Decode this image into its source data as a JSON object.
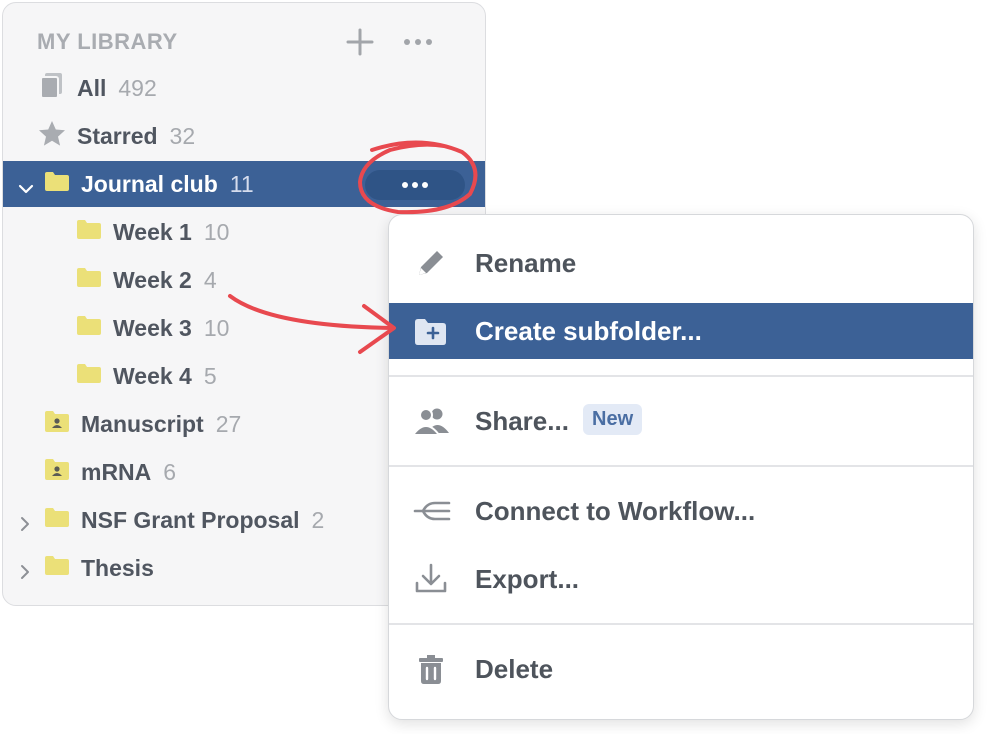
{
  "library": {
    "header": "MY LIBRARY",
    "add_icon": "plus-icon",
    "more_icon": "more-horizontal-icon",
    "items": [
      {
        "label": "All",
        "count": "492",
        "icon": "documents-icon"
      },
      {
        "label": "Starred",
        "count": "32",
        "icon": "star-icon"
      },
      {
        "label": "Journal club",
        "count": "11",
        "icon": "folder-icon",
        "expanded": true,
        "selected": true
      },
      {
        "label": "Week 1",
        "count": "10",
        "icon": "folder-icon"
      },
      {
        "label": "Week 2",
        "count": "4",
        "icon": "folder-icon"
      },
      {
        "label": "Week 3",
        "count": "10",
        "icon": "folder-icon"
      },
      {
        "label": "Week 4",
        "count": "5",
        "icon": "folder-icon"
      },
      {
        "label": "Manuscript",
        "count": "27",
        "icon": "shared-folder-icon"
      },
      {
        "label": "mRNA",
        "count": "6",
        "icon": "shared-folder-icon"
      },
      {
        "label": "NSF Grant Proposal",
        "count": "2",
        "icon": "folder-icon",
        "collapsed": true
      },
      {
        "label": "Thesis",
        "count": "",
        "icon": "folder-icon",
        "collapsed": true
      }
    ]
  },
  "menu": {
    "rename": "Rename",
    "create_subfolder": "Create subfolder...",
    "share": "Share...",
    "share_badge": "New",
    "connect_workflow": "Connect to Workflow...",
    "export": "Export...",
    "delete": "Delete"
  },
  "colors": {
    "selection": "#3c6196",
    "annotation": "#e8494f",
    "folder": "#ebe078"
  }
}
